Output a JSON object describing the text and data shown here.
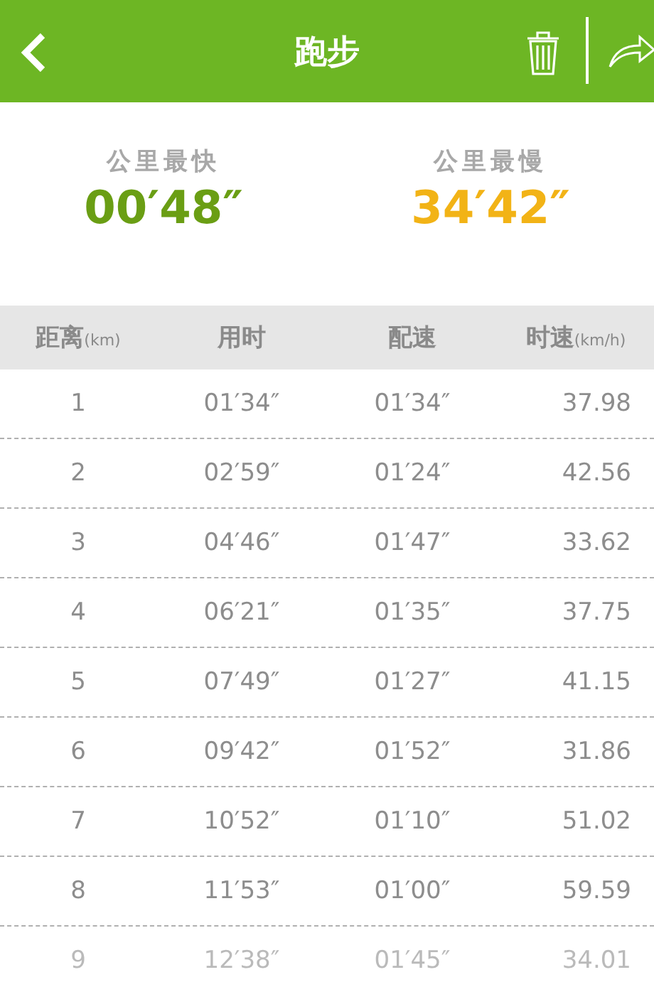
{
  "app_bar": {
    "title": "跑步"
  },
  "summary": [
    {
      "label": "公里最快",
      "value": "00′48″",
      "color": "#6a9e14"
    },
    {
      "label": "公里最慢",
      "value": "34′42″",
      "color": "#f2b316"
    }
  ],
  "table": {
    "columns": [
      {
        "label": "距离",
        "unit": "(km)"
      },
      {
        "label": "用时"
      },
      {
        "label": "配速"
      },
      {
        "label": "时速",
        "unit": "(km/h)"
      }
    ],
    "rows": [
      [
        "1",
        "01′34″",
        "01′34″",
        "37.98"
      ],
      [
        "2",
        "02′59″",
        "01′24″",
        "42.56"
      ],
      [
        "3",
        "04′46″",
        "01′47″",
        "33.62"
      ],
      [
        "4",
        "06′21″",
        "01′35″",
        "37.75"
      ],
      [
        "5",
        "07′49″",
        "01′27″",
        "41.15"
      ],
      [
        "6",
        "09′42″",
        "01′52″",
        "31.86"
      ],
      [
        "7",
        "10′52″",
        "01′10″",
        "51.02"
      ],
      [
        "8",
        "11′53″",
        "01′00″",
        "59.59"
      ],
      [
        "9",
        "12′38″",
        "01′45″",
        "34.01"
      ]
    ]
  }
}
